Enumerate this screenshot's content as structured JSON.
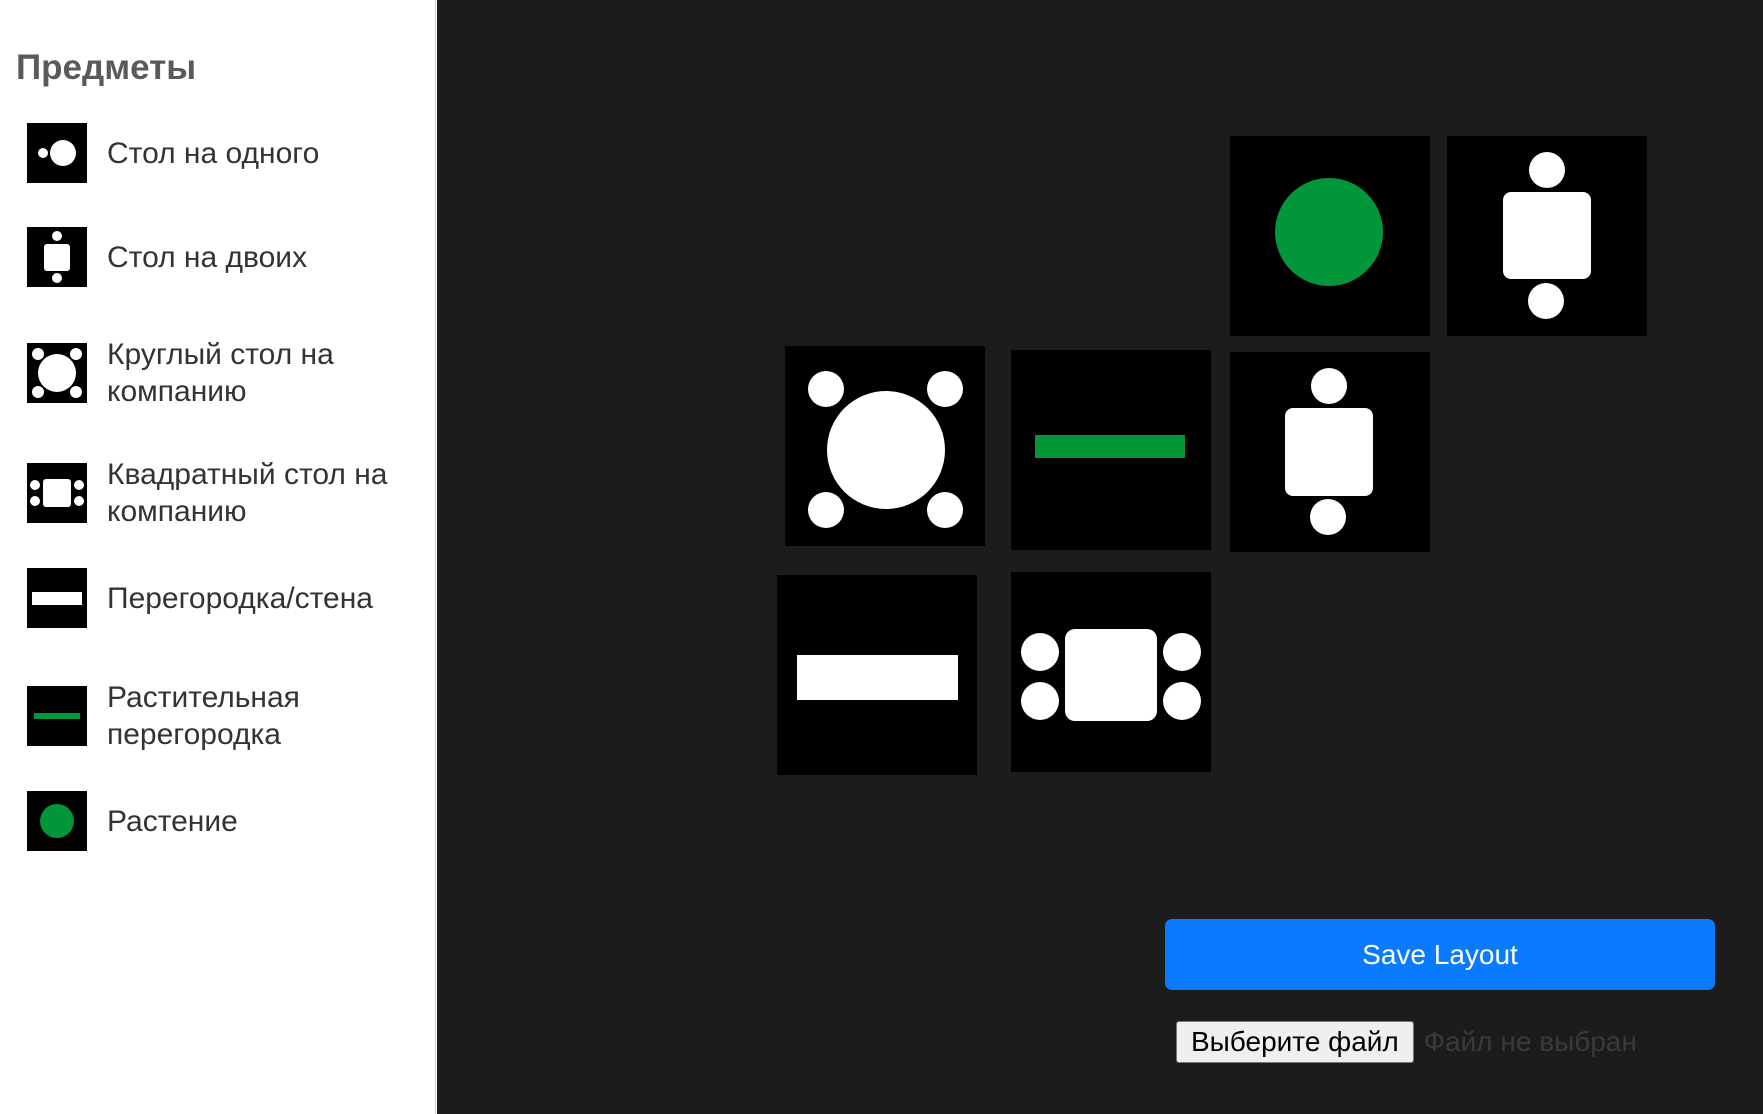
{
  "sidebar": {
    "title": "Предметы",
    "items": [
      {
        "label": "Стол на одного",
        "icon": "single-table-icon"
      },
      {
        "label": "Стол на двоих",
        "icon": "two-person-table-icon"
      },
      {
        "label": "Круглый стол на компанию",
        "icon": "round-group-table-icon"
      },
      {
        "label": "Квадратный стол на компанию",
        "icon": "square-group-table-icon"
      },
      {
        "label": "Перегородка/стена",
        "icon": "wall-partition-icon"
      },
      {
        "label": "Растительная перегородка",
        "icon": "plant-partition-icon"
      },
      {
        "label": "Растение",
        "icon": "plant-icon"
      }
    ]
  },
  "canvas": {
    "tiles": [
      {
        "type": "plant"
      },
      {
        "type": "two-person-table"
      },
      {
        "type": "round-group-table"
      },
      {
        "type": "plant-partition"
      },
      {
        "type": "two-person-table"
      },
      {
        "type": "wall-partition"
      },
      {
        "type": "square-group-table"
      }
    ]
  },
  "actions": {
    "save_label": "Save Layout",
    "file_button_label": "Выберите файл",
    "file_status": "Файл не выбран"
  },
  "colors": {
    "canvas_background": "#1c1c1c",
    "tile_background": "#000000",
    "plant_green": "#009639",
    "save_button_blue": "#0a7bff"
  }
}
